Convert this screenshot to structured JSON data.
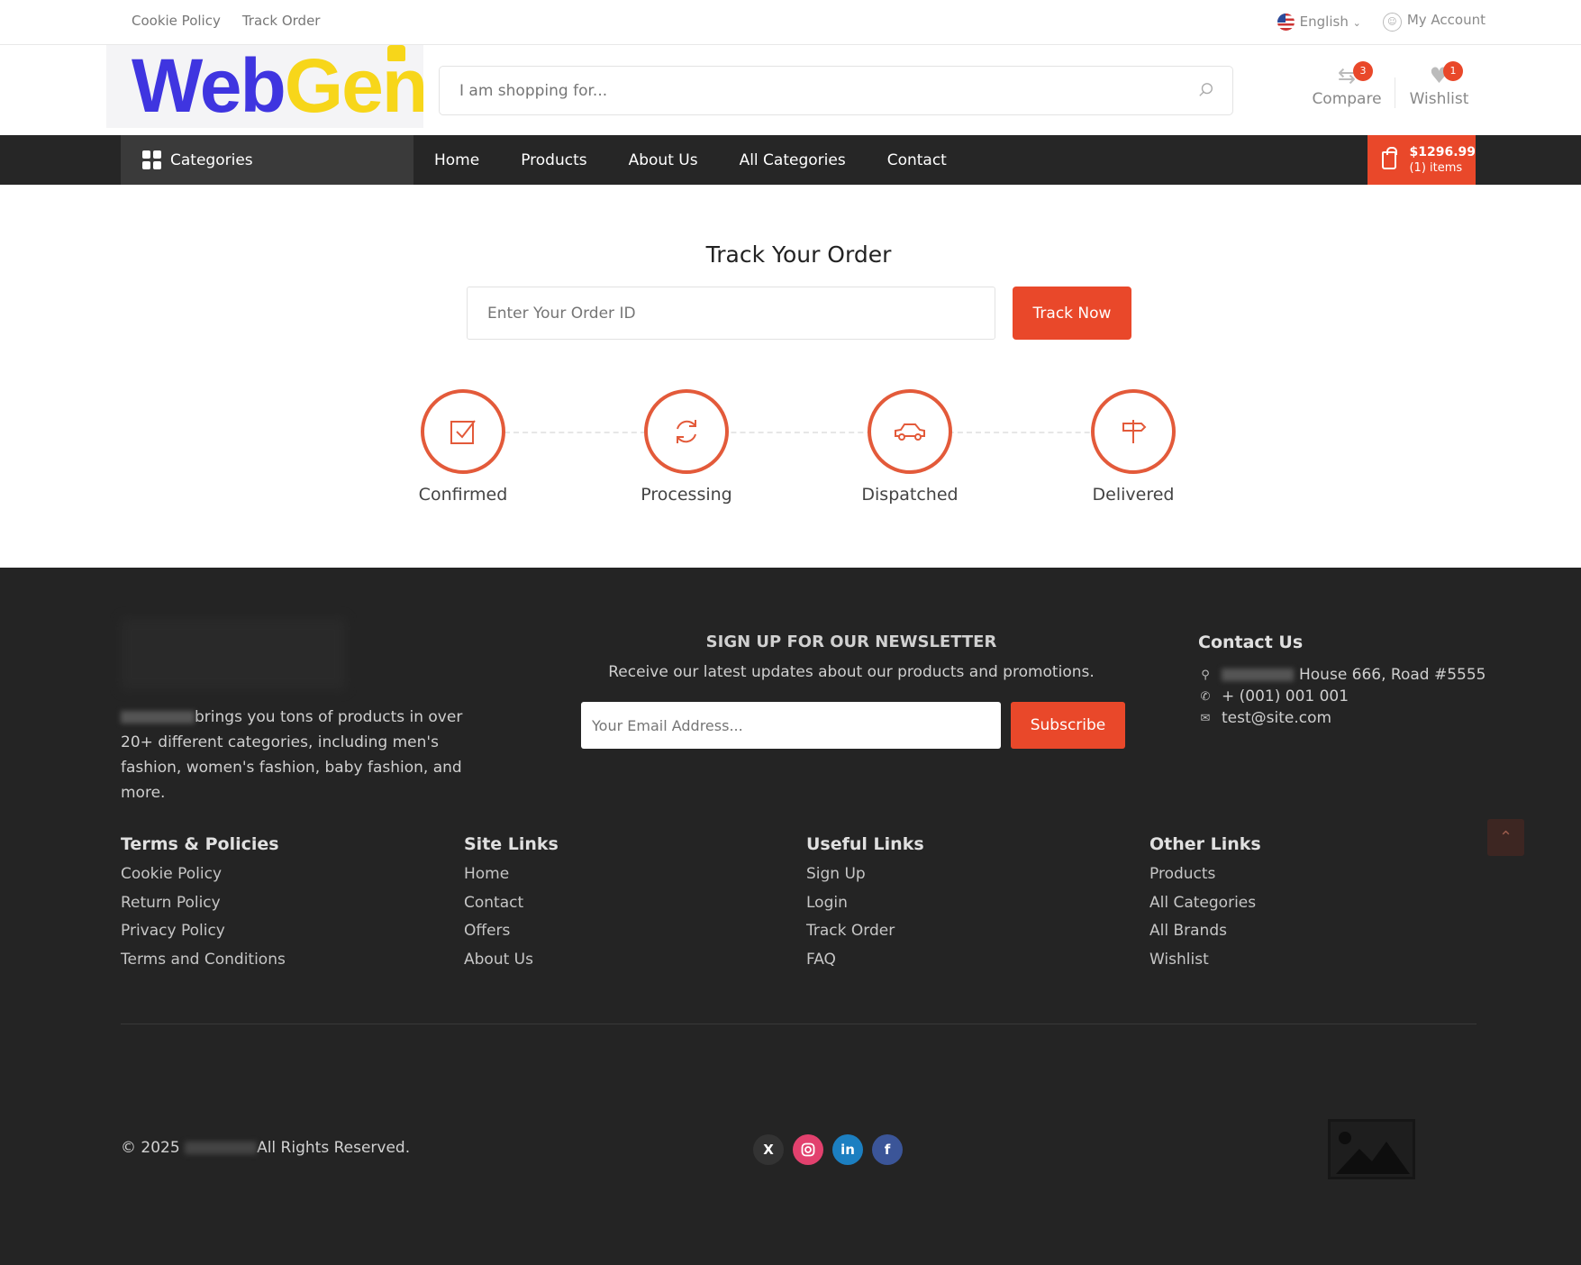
{
  "topbar": {
    "links": [
      "Cookie Policy",
      "Track Order"
    ],
    "language": "English",
    "account": "My Account"
  },
  "brand": {
    "logo_part1": "Web",
    "logo_part2": "Gen"
  },
  "search": {
    "placeholder": "I am shopping for..."
  },
  "header_icons": {
    "compare_label": "Compare",
    "compare_count": "3",
    "wishlist_label": "Wishlist",
    "wishlist_count": "1"
  },
  "nav": {
    "categories": "Categories",
    "items": [
      "Home",
      "Products",
      "About Us",
      "All Categories",
      "Contact"
    ],
    "cart_total": "$1296.99",
    "cart_items": "(1) items"
  },
  "track": {
    "title": "Track Your Order",
    "input_placeholder": "Enter Your Order ID",
    "button": "Track Now",
    "steps": [
      "Confirmed",
      "Processing",
      "Dispatched",
      "Delivered"
    ]
  },
  "footer": {
    "about_text": "brings you tons of products in over 20+ different categories, including men's fashion, women's fashion, baby fashion, and more.",
    "newsletter": {
      "title": "SIGN UP FOR OUR NEWSLETTER",
      "subtitle": "Receive our latest updates about our products and promotions.",
      "placeholder": "Your Email Address...",
      "button": "Subscribe"
    },
    "contact": {
      "title": "Contact Us",
      "address": "House 666, Road #5555",
      "phone": "+ (001) 001 001",
      "email": "test@site.com"
    },
    "columns": [
      {
        "title": "Terms & Policies",
        "links": [
          "Cookie Policy",
          "Return Policy",
          "Privacy Policy",
          "Terms and Conditions"
        ]
      },
      {
        "title": "Site Links",
        "links": [
          "Home",
          "Contact",
          "Offers",
          "About Us"
        ]
      },
      {
        "title": "Useful Links",
        "links": [
          "Sign Up",
          "Login",
          "Track Order",
          "FAQ"
        ]
      },
      {
        "title": "Other Links",
        "links": [
          "Products",
          "All Categories",
          "All Brands",
          "Wishlist"
        ]
      }
    ],
    "copyright_prefix": "© 2025",
    "copyright_suffix": "All Rights Reserved.",
    "social": [
      "x-icon",
      "instagram-icon",
      "linkedin-icon",
      "facebook-icon"
    ]
  },
  "colors": {
    "accent": "#e9482a",
    "nav_bg": "#262626",
    "footer_bg": "#242424"
  }
}
